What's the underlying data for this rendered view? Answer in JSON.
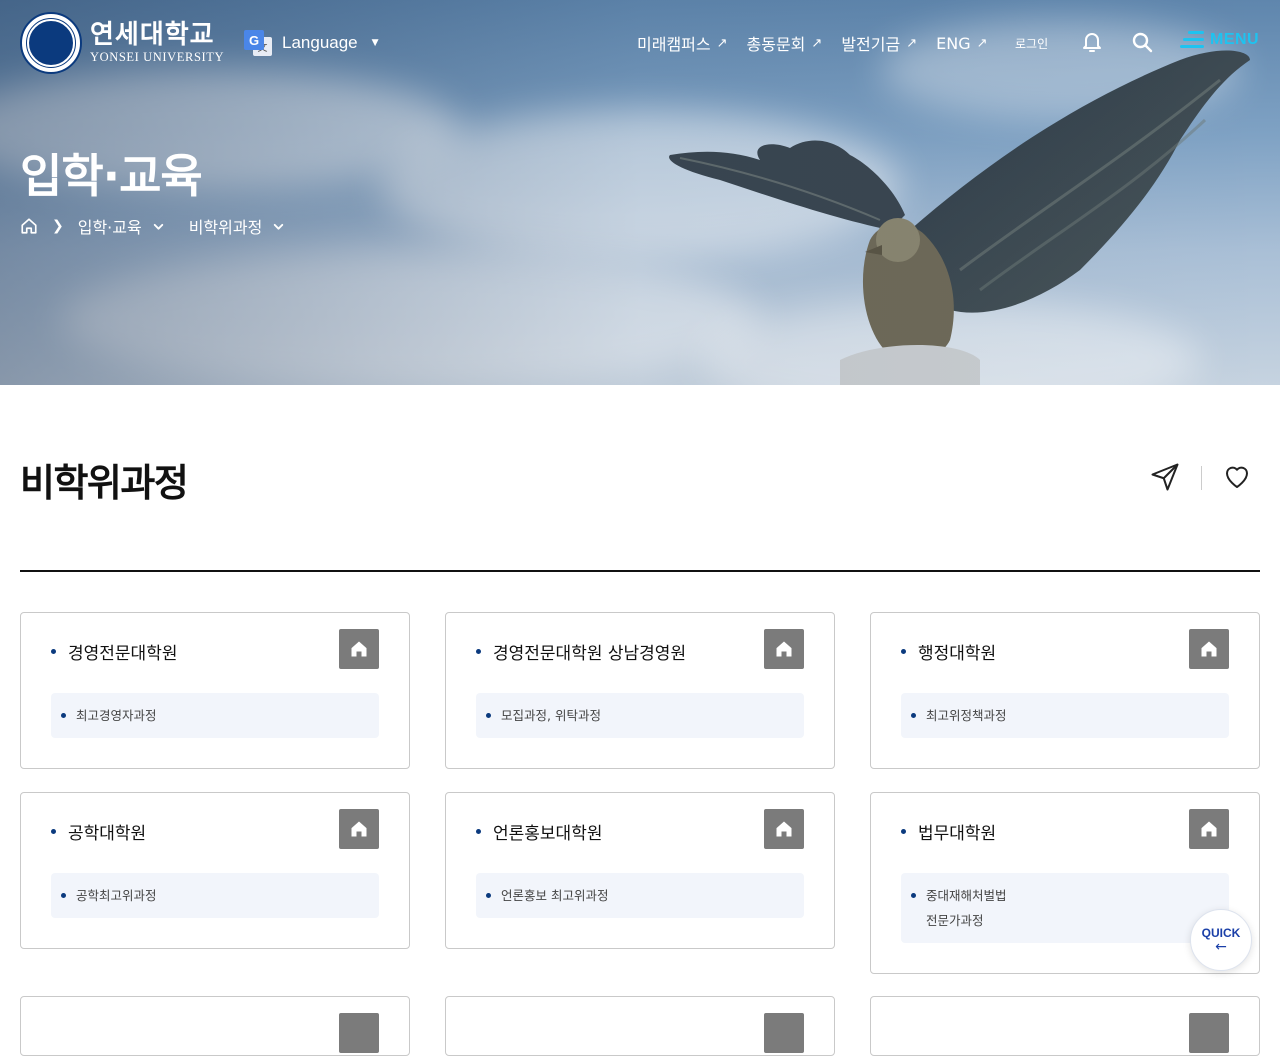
{
  "header": {
    "logo_ko": "연세대학교",
    "logo_en": "YONSEI UNIVERSITY",
    "language_label": "Language",
    "nav": [
      {
        "label": "미래캠퍼스"
      },
      {
        "label": "총동문회"
      },
      {
        "label": "발전기금"
      },
      {
        "label": "ENG"
      }
    ],
    "login_label": "로그인",
    "menu_label": "MENU"
  },
  "hero": {
    "title": "입학·교육",
    "breadcrumb": [
      "입학·교육",
      "비학위과정"
    ]
  },
  "page": {
    "title": "비학위과정"
  },
  "cards": [
    {
      "title": "경영전문대학원",
      "items": [
        "최고경영자과정"
      ]
    },
    {
      "title": "경영전문대학원 상남경영원",
      "items": [
        "모집과정, 위탁과정"
      ]
    },
    {
      "title": "행정대학원",
      "items": [
        "최고위정책과정"
      ]
    },
    {
      "title": "공학대학원",
      "items": [
        "공학최고위과정"
      ]
    },
    {
      "title": "언론홍보대학원",
      "items": [
        "언론홍보 최고위과정"
      ]
    },
    {
      "title": "법무대학원",
      "items": [
        "중대재해처벌법",
        "전문가과정"
      ]
    }
  ],
  "quick": {
    "label": "QUICK"
  },
  "colors": {
    "brand": "#0b3a7e",
    "menu_accent": "#1ec3f0",
    "quick_accent": "#1a3fa8",
    "home_button": "#7b7b7b"
  }
}
